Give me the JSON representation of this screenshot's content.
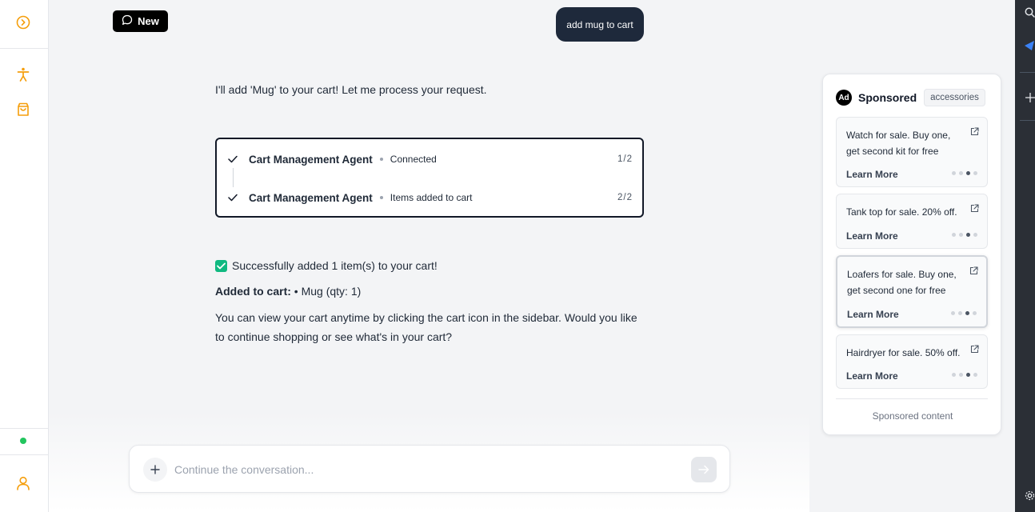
{
  "colors": {
    "accent": "#f59e0b",
    "dark": "#1e293b",
    "success": "#10b981",
    "online": "#22c55e"
  },
  "sidebar": {
    "icons": [
      "collapse-chevron-icon",
      "accessibility-icon",
      "shopping-bag-icon",
      "user-icon"
    ]
  },
  "header": {
    "new_label": "New"
  },
  "chat": {
    "user_message": "add mug to cart",
    "assistant_intro": "I'll add 'Mug' to your cart! Let me process your request.",
    "agent_steps": [
      {
        "name": "Cart Management Agent",
        "status": "Connected",
        "step": "1/2"
      },
      {
        "name": "Cart Management Agent",
        "status": "Items added to cart",
        "step": "2/2"
      }
    ],
    "success_text": "Successfully added 1 item(s) to your cart!",
    "added_label": "Added to cart:",
    "added_items": "• Mug (qty: 1)",
    "followup": "You can view your cart anytime by clicking the cart icon in the sidebar. Would you like to continue shopping or see what's in your cart?"
  },
  "composer": {
    "placeholder": "Continue the conversation..."
  },
  "ads": {
    "badge": "Ad",
    "title": "Sponsored",
    "tag": "accessories",
    "items": [
      {
        "text": "Watch for sale. Buy one, get second kit for free",
        "cta": "Learn More"
      },
      {
        "text": "Tank top for sale. 20% off.",
        "cta": "Learn More"
      },
      {
        "text": "Loafers for sale. Buy one, get second one for free",
        "cta": "Learn More"
      },
      {
        "text": "Hairdryer for sale. 50% off.",
        "cta": "Learn More"
      }
    ],
    "footer": "Sponsored content"
  }
}
